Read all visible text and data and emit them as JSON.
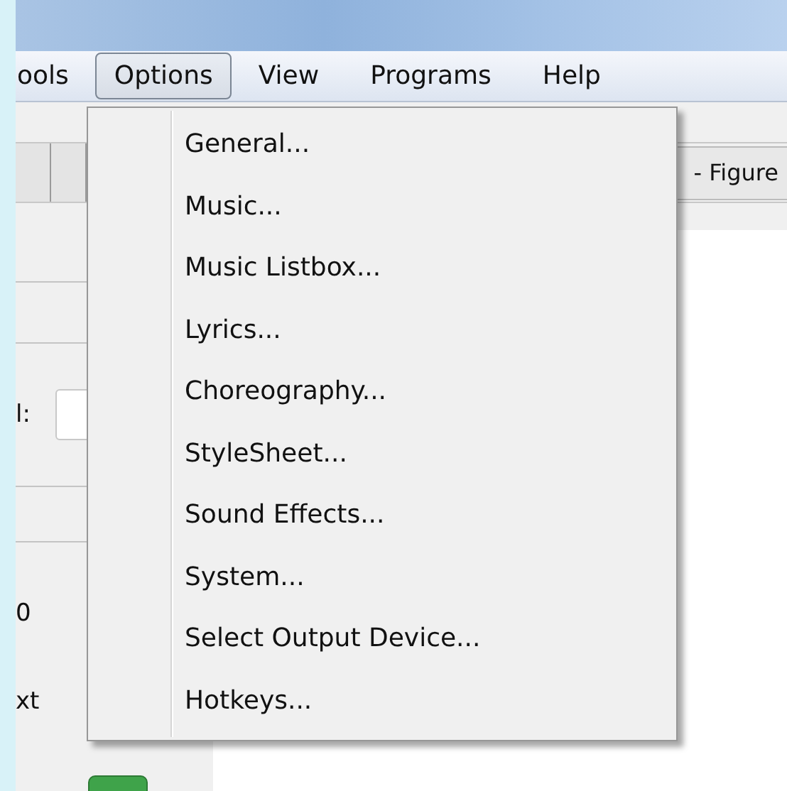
{
  "menu_bar": [
    {
      "label": "ools",
      "selected": false
    },
    {
      "label": "Options",
      "selected": true
    },
    {
      "label": "View",
      "selected": false
    },
    {
      "label": "Programs",
      "selected": false
    },
    {
      "label": "Help",
      "selected": false
    }
  ],
  "toolbar": {
    "tab_label": "- Figure"
  },
  "left_panel": {
    "field_label": "l:",
    "value_text": "0",
    "caption": "xt"
  },
  "options_menu": {
    "items": [
      "General...",
      "Music...",
      "Music Listbox...",
      "Lyrics...",
      "Choreography...",
      "StyleSheet...",
      "Sound Effects...",
      "System...",
      "Select Output Device...",
      "Hotkeys..."
    ]
  }
}
